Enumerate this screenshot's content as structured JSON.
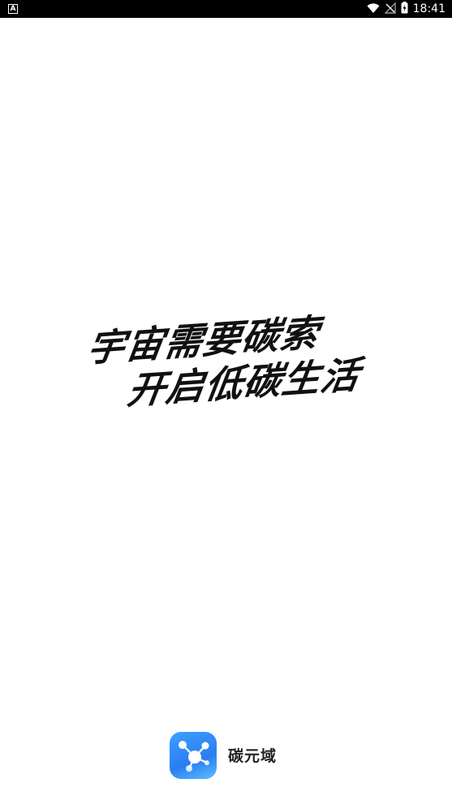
{
  "status_bar": {
    "left_icon_letter": "A",
    "time": "18:41",
    "icons": [
      "wifi-icon",
      "signal-off-icon",
      "battery-charging-icon"
    ]
  },
  "slogan": {
    "line1": "宇宙需要碳索",
    "line2": "开启低碳生活"
  },
  "brand": {
    "name": "碳元域",
    "logo_icon": "molecule-network-icon",
    "logo_color": "#2f8cff"
  },
  "colors": {
    "background": "#ffffff",
    "status_bar": "#000000",
    "text": "#111111"
  }
}
